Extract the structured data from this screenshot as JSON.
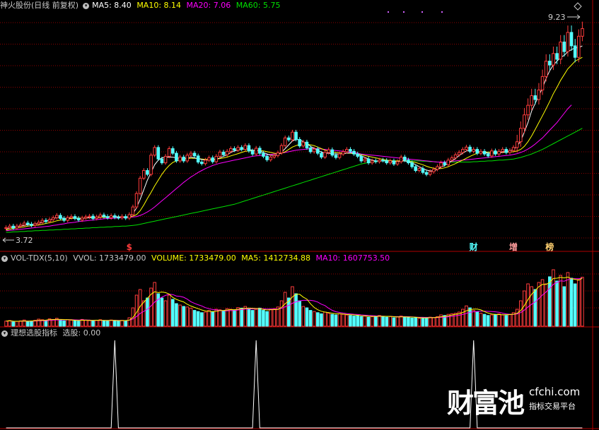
{
  "colors": {
    "up": "#ff3c3c",
    "down": "#54ffff",
    "ma5": "#ffffff",
    "ma10": "#ffff00",
    "ma20": "#ff00ff",
    "ma60": "#00e000",
    "grid": "#8b0000",
    "text": "#c8c8c8"
  },
  "main_header": {
    "title": "神火股份(日线 前复权)",
    "ma5": "MA5: 8.40",
    "ma10": "MA10: 8.14",
    "ma20": "MA20: 7.06",
    "ma60": "MA60: 5.75"
  },
  "main_panel": {
    "high_label": "9.23",
    "low_label": "3.72",
    "markers": [
      {
        "text": "$",
        "bar": 34,
        "color": "#ff3c3c"
      },
      {
        "text": "财",
        "bar": 129,
        "color": "#54ffff"
      },
      {
        "text": "增",
        "bar": 140,
        "color": "#ff9c9c"
      },
      {
        "text": "榜",
        "bar": 150,
        "color": "#ffd070"
      }
    ]
  },
  "volume_header": {
    "name": "VOL-TDX(5,10)",
    "vvol": "VVOL: 1733479.00",
    "volume": "VOLUME: 1733479.00",
    "ma5": "MA5: 1412734.88",
    "ma10": "MA10: 1607753.50"
  },
  "indicator_header": {
    "name": "理想选股指标",
    "value": "选股: 0.00"
  },
  "watermark": {
    "brand": "财富池",
    "url": "cfchi.com",
    "tagline": "指标交易平台"
  },
  "chart_data": [
    {
      "type": "candlestick",
      "name": "price",
      "xlabel": "",
      "ylabel": "",
      "ylim": [
        3.5,
        9.5
      ],
      "close": [
        3.86,
        3.9,
        3.85,
        3.9,
        3.93,
        3.98,
        3.95,
        3.92,
        3.96,
        4.0,
        4.05,
        4.02,
        4.07,
        4.12,
        4.18,
        4.1,
        4.05,
        4.12,
        4.15,
        4.1,
        4.06,
        4.11,
        4.14,
        4.16,
        4.1,
        4.14,
        4.19,
        4.15,
        4.12,
        4.17,
        4.13,
        4.12,
        4.15,
        4.11,
        4.2,
        4.4,
        4.75,
        5.15,
        5.35,
        5.25,
        5.75,
        5.95,
        5.65,
        5.55,
        5.72,
        5.92,
        5.8,
        5.6,
        5.7,
        5.6,
        5.75,
        5.8,
        5.73,
        5.57,
        5.53,
        5.62,
        5.68,
        5.58,
        5.72,
        5.83,
        5.76,
        5.85,
        5.92,
        5.88,
        5.95,
        5.9,
        6.0,
        5.86,
        5.78,
        5.93,
        5.8,
        5.72,
        5.63,
        5.7,
        5.74,
        5.81,
        6.0,
        6.2,
        6.15,
        6.35,
        6.16,
        5.99,
        6.09,
        5.94,
        5.84,
        5.91,
        5.8,
        5.7,
        5.82,
        5.89,
        5.75,
        5.69,
        5.78,
        5.84,
        5.9,
        5.85,
        5.78,
        5.72,
        5.6,
        5.65,
        5.55,
        5.6,
        5.58,
        5.62,
        5.61,
        5.55,
        5.6,
        5.52,
        5.58,
        5.7,
        5.62,
        5.55,
        5.45,
        5.35,
        5.4,
        5.3,
        5.25,
        5.32,
        5.38,
        5.45,
        5.55,
        5.5,
        5.62,
        5.68,
        5.76,
        5.82,
        5.9,
        5.96,
        5.85,
        5.9,
        5.8,
        5.85,
        5.78,
        5.73,
        5.86,
        5.78,
        5.85,
        5.9,
        5.82,
        5.87,
        5.95,
        6.1,
        6.45,
        6.8,
        7.05,
        7.3,
        7.2,
        7.45,
        7.8,
        8.2,
        8.1,
        8.4,
        8.25,
        8.7,
        8.45,
        8.95,
        8.6,
        8.3,
        8.85,
        9.05
      ],
      "ma5": [
        3.82,
        3.86,
        3.87,
        3.88,
        3.9,
        3.92,
        3.94,
        3.95,
        3.96,
        3.97,
        4.0,
        4.03,
        4.06,
        4.09,
        4.13,
        4.12,
        4.1,
        4.11,
        4.12,
        4.11,
        4.1,
        4.1,
        4.11,
        4.12,
        4.12,
        4.13,
        4.15,
        4.15,
        4.14,
        4.15,
        4.15,
        4.14,
        4.14,
        4.13,
        4.15,
        4.22,
        4.38,
        4.6,
        4.85,
        5.1,
        5.3,
        5.5,
        5.62,
        5.68,
        5.7,
        5.7,
        5.7,
        5.68,
        5.66,
        5.65,
        5.68,
        5.7,
        5.68,
        5.66,
        5.64,
        5.62,
        5.62,
        5.62,
        5.64,
        5.68,
        5.72,
        5.76,
        5.82,
        5.86,
        5.88,
        5.9,
        5.92,
        5.9,
        5.88,
        5.87,
        5.86,
        5.82,
        5.78,
        5.75,
        5.74,
        5.76,
        5.82,
        5.92,
        6.02,
        6.12,
        6.16,
        6.15,
        6.1,
        6.05,
        5.98,
        5.93,
        5.88,
        5.83,
        5.8,
        5.8,
        5.79,
        5.78,
        5.78,
        5.79,
        5.8,
        5.81,
        5.8,
        5.77,
        5.73,
        5.69,
        5.65,
        5.62,
        5.6,
        5.6,
        5.6,
        5.6,
        5.59,
        5.58,
        5.58,
        5.6,
        5.6,
        5.58,
        5.55,
        5.5,
        5.45,
        5.4,
        5.36,
        5.34,
        5.34,
        5.38,
        5.44,
        5.48,
        5.54,
        5.6,
        5.66,
        5.74,
        5.8,
        5.86,
        5.88,
        5.88,
        5.86,
        5.84,
        5.82,
        5.8,
        5.8,
        5.8,
        5.81,
        5.83,
        5.84,
        5.86,
        5.9,
        5.98,
        6.12,
        6.35,
        6.6,
        6.9,
        7.1,
        7.3,
        7.5,
        7.75,
        7.95,
        8.1,
        8.2,
        8.3,
        8.35,
        8.45,
        8.5,
        8.55,
        8.55,
        8.6
      ],
      "ma10": [
        3.8,
        3.82,
        3.84,
        3.85,
        3.87,
        3.88,
        3.9,
        3.91,
        3.92,
        3.93,
        3.95,
        3.97,
        3.99,
        4.01,
        4.04,
        4.06,
        4.07,
        4.09,
        4.1,
        4.11,
        4.11,
        4.11,
        4.11,
        4.12,
        4.12,
        4.12,
        4.13,
        4.13,
        4.13,
        4.14,
        4.14,
        4.14,
        4.14,
        4.14,
        4.14,
        4.16,
        4.2,
        4.3,
        4.45,
        4.62,
        4.78,
        4.95,
        5.1,
        5.25,
        5.38,
        5.48,
        5.56,
        5.6,
        5.63,
        5.65,
        5.66,
        5.67,
        5.67,
        5.66,
        5.65,
        5.64,
        5.64,
        5.64,
        5.65,
        5.66,
        5.68,
        5.7,
        5.73,
        5.76,
        5.79,
        5.82,
        5.85,
        5.86,
        5.87,
        5.87,
        5.87,
        5.86,
        5.84,
        5.82,
        5.8,
        5.79,
        5.8,
        5.84,
        5.9,
        5.96,
        6.0,
        6.03,
        6.04,
        6.04,
        6.02,
        6.0,
        5.96,
        5.92,
        5.88,
        5.85,
        5.83,
        5.82,
        5.81,
        5.8,
        5.8,
        5.8,
        5.79,
        5.78,
        5.76,
        5.74,
        5.72,
        5.7,
        5.68,
        5.66,
        5.64,
        5.62,
        5.61,
        5.6,
        5.6,
        5.6,
        5.6,
        5.59,
        5.58,
        5.56,
        5.53,
        5.5,
        5.46,
        5.43,
        5.41,
        5.4,
        5.4,
        5.42,
        5.45,
        5.49,
        5.53,
        5.58,
        5.62,
        5.67,
        5.72,
        5.76,
        5.8,
        5.82,
        5.83,
        5.83,
        5.83,
        5.82,
        5.82,
        5.82,
        5.83,
        5.83,
        5.84,
        5.86,
        5.9,
        5.98,
        6.1,
        6.25,
        6.42,
        6.6,
        6.78,
        6.96,
        7.15,
        7.35,
        7.52,
        7.7,
        7.85,
        8.0,
        8.1,
        8.2,
        8.25,
        8.3
      ],
      "ma20": [
        3.78,
        3.79,
        3.8,
        3.81,
        3.82,
        3.83,
        3.84,
        3.85,
        3.86,
        3.87,
        3.88,
        3.89,
        3.9,
        3.92,
        3.93,
        3.95,
        3.96,
        3.98,
        3.99,
        4.0,
        4.02,
        4.03,
        4.04,
        4.05,
        4.06,
        4.07,
        4.08,
        4.09,
        4.1,
        4.1,
        4.11,
        4.11,
        4.12,
        4.12,
        4.13,
        4.14,
        4.15,
        4.18,
        4.22,
        4.27,
        4.33,
        4.4,
        4.48,
        4.56,
        4.64,
        4.72,
        4.8,
        4.88,
        4.96,
        5.04,
        5.11,
        5.18,
        5.24,
        5.3,
        5.35,
        5.4,
        5.44,
        5.48,
        5.51,
        5.54,
        5.56,
        5.58,
        5.6,
        5.62,
        5.64,
        5.66,
        5.68,
        5.7,
        5.72,
        5.73,
        5.74,
        5.75,
        5.76,
        5.77,
        5.78,
        5.79,
        5.8,
        5.82,
        5.84,
        5.86,
        5.88,
        5.89,
        5.9,
        5.91,
        5.92,
        5.92,
        5.92,
        5.91,
        5.9,
        5.89,
        5.88,
        5.87,
        5.86,
        5.85,
        5.84,
        5.83,
        5.82,
        5.8,
        5.78,
        5.77,
        5.76,
        5.75,
        5.74,
        5.73,
        5.72,
        5.71,
        5.7,
        5.69,
        5.68,
        5.67,
        5.66,
        5.65,
        5.64,
        5.63,
        5.62,
        5.61,
        5.6,
        5.59,
        5.58,
        5.57,
        5.57,
        5.57,
        5.58,
        5.59,
        5.6,
        5.61,
        5.62,
        5.63,
        5.64,
        5.65,
        5.66,
        5.67,
        5.68,
        5.69,
        5.7,
        5.71,
        5.72,
        5.73,
        5.74,
        5.75,
        5.77,
        5.79,
        5.82,
        5.86,
        5.91,
        5.97,
        6.04,
        6.12,
        6.2,
        6.3,
        6.4,
        6.5,
        6.6,
        6.72,
        6.84,
        6.96,
        7.06
      ],
      "ma60": [
        3.74,
        3.74,
        3.75,
        3.75,
        3.76,
        3.76,
        3.77,
        3.77,
        3.78,
        3.78,
        3.79,
        3.79,
        3.8,
        3.8,
        3.81,
        3.81,
        3.82,
        3.82,
        3.83,
        3.83,
        3.84,
        3.84,
        3.85,
        3.85,
        3.86,
        3.86,
        3.87,
        3.87,
        3.88,
        3.88,
        3.89,
        3.89,
        3.9,
        3.9,
        3.91,
        3.92,
        3.93,
        3.95,
        3.97,
        3.99,
        4.01,
        4.03,
        4.05,
        4.07,
        4.09,
        4.11,
        4.13,
        4.15,
        4.17,
        4.19,
        4.21,
        4.23,
        4.25,
        4.27,
        4.29,
        4.31,
        4.33,
        4.35,
        4.37,
        4.39,
        4.41,
        4.43,
        4.45,
        4.47,
        4.5,
        4.53,
        4.56,
        4.59,
        4.62,
        4.65,
        4.68,
        4.71,
        4.74,
        4.77,
        4.8,
        4.83,
        4.86,
        4.89,
        4.92,
        4.95,
        4.98,
        5.01,
        5.04,
        5.07,
        5.1,
        5.13,
        5.16,
        5.19,
        5.22,
        5.25,
        5.28,
        5.31,
        5.34,
        5.37,
        5.4,
        5.43,
        5.46,
        5.49,
        5.52,
        5.54,
        5.56,
        5.57,
        5.58,
        5.59,
        5.6,
        5.6,
        5.6,
        5.6,
        5.6,
        5.6,
        5.6,
        5.6,
        5.6,
        5.6,
        5.6,
        5.59,
        5.59,
        5.58,
        5.58,
        5.57,
        5.57,
        5.57,
        5.57,
        5.57,
        5.57,
        5.57,
        5.57,
        5.57,
        5.57,
        5.58,
        5.58,
        5.59,
        5.59,
        5.6,
        5.6,
        5.61,
        5.62,
        5.62,
        5.63,
        5.64,
        5.65,
        5.67,
        5.69,
        5.72,
        5.75,
        5.78,
        5.82,
        5.86,
        5.9,
        5.95,
        6.0,
        6.05,
        6.1,
        6.15,
        6.2,
        6.25,
        6.3,
        6.35,
        6.4,
        6.45
      ]
    },
    {
      "type": "bar",
      "name": "volume",
      "xlabel": "",
      "ylabel": "",
      "ylim": [
        0,
        2200000
      ],
      "values": [
        180000,
        200000,
        150000,
        170000,
        190000,
        220000,
        160000,
        180000,
        210000,
        250000,
        230000,
        200000,
        260000,
        240000,
        280000,
        220000,
        190000,
        230000,
        210000,
        200000,
        180000,
        240000,
        220000,
        200000,
        190000,
        210000,
        230000,
        200000,
        180000,
        220000,
        200000,
        190000,
        210000,
        180000,
        300000,
        650000,
        1100000,
        1300000,
        900000,
        1000000,
        1350000,
        1550000,
        1150000,
        1000000,
        900000,
        1100000,
        950000,
        800000,
        750000,
        700000,
        680000,
        640000,
        560000,
        520000,
        480000,
        500000,
        560000,
        520000,
        600000,
        580000,
        540000,
        620000,
        600000,
        580000,
        660000,
        640000,
        700000,
        620000,
        560000,
        600000,
        640000,
        560000,
        520000,
        600000,
        620000,
        680000,
        900000,
        1200000,
        1000000,
        1400000,
        1150000,
        900000,
        700000,
        650000,
        560000,
        520000,
        480000,
        440000,
        500000,
        460000,
        420000,
        400000,
        440000,
        420000,
        400000,
        380000,
        360000,
        380000,
        340000,
        360000,
        320000,
        340000,
        360000,
        380000,
        350000,
        320000,
        340000,
        300000,
        330000,
        360000,
        330000,
        310000,
        290000,
        300000,
        280000,
        300000,
        310000,
        320000,
        300000,
        340000,
        400000,
        380000,
        420000,
        440000,
        460000,
        500000,
        600000,
        720000,
        650000,
        560000,
        500000,
        460000,
        420000,
        380000,
        400000,
        420000,
        440000,
        400000,
        380000,
        420000,
        480000,
        600000,
        900000,
        1250000,
        1500000,
        1400000,
        1300000,
        1550000,
        1650000,
        1500000,
        1750000,
        2000000,
        1600000,
        1800000,
        1400000,
        1900000,
        1700000,
        1500000,
        1650000,
        1733479
      ]
    },
    {
      "type": "line",
      "name": "理想选股指标",
      "xlabel": "",
      "ylabel": "",
      "ylim": [
        0,
        1
      ],
      "spikes_at_bars": [
        30,
        69,
        129
      ],
      "values_note": "0 everywhere except value 1 at spike bars"
    }
  ]
}
